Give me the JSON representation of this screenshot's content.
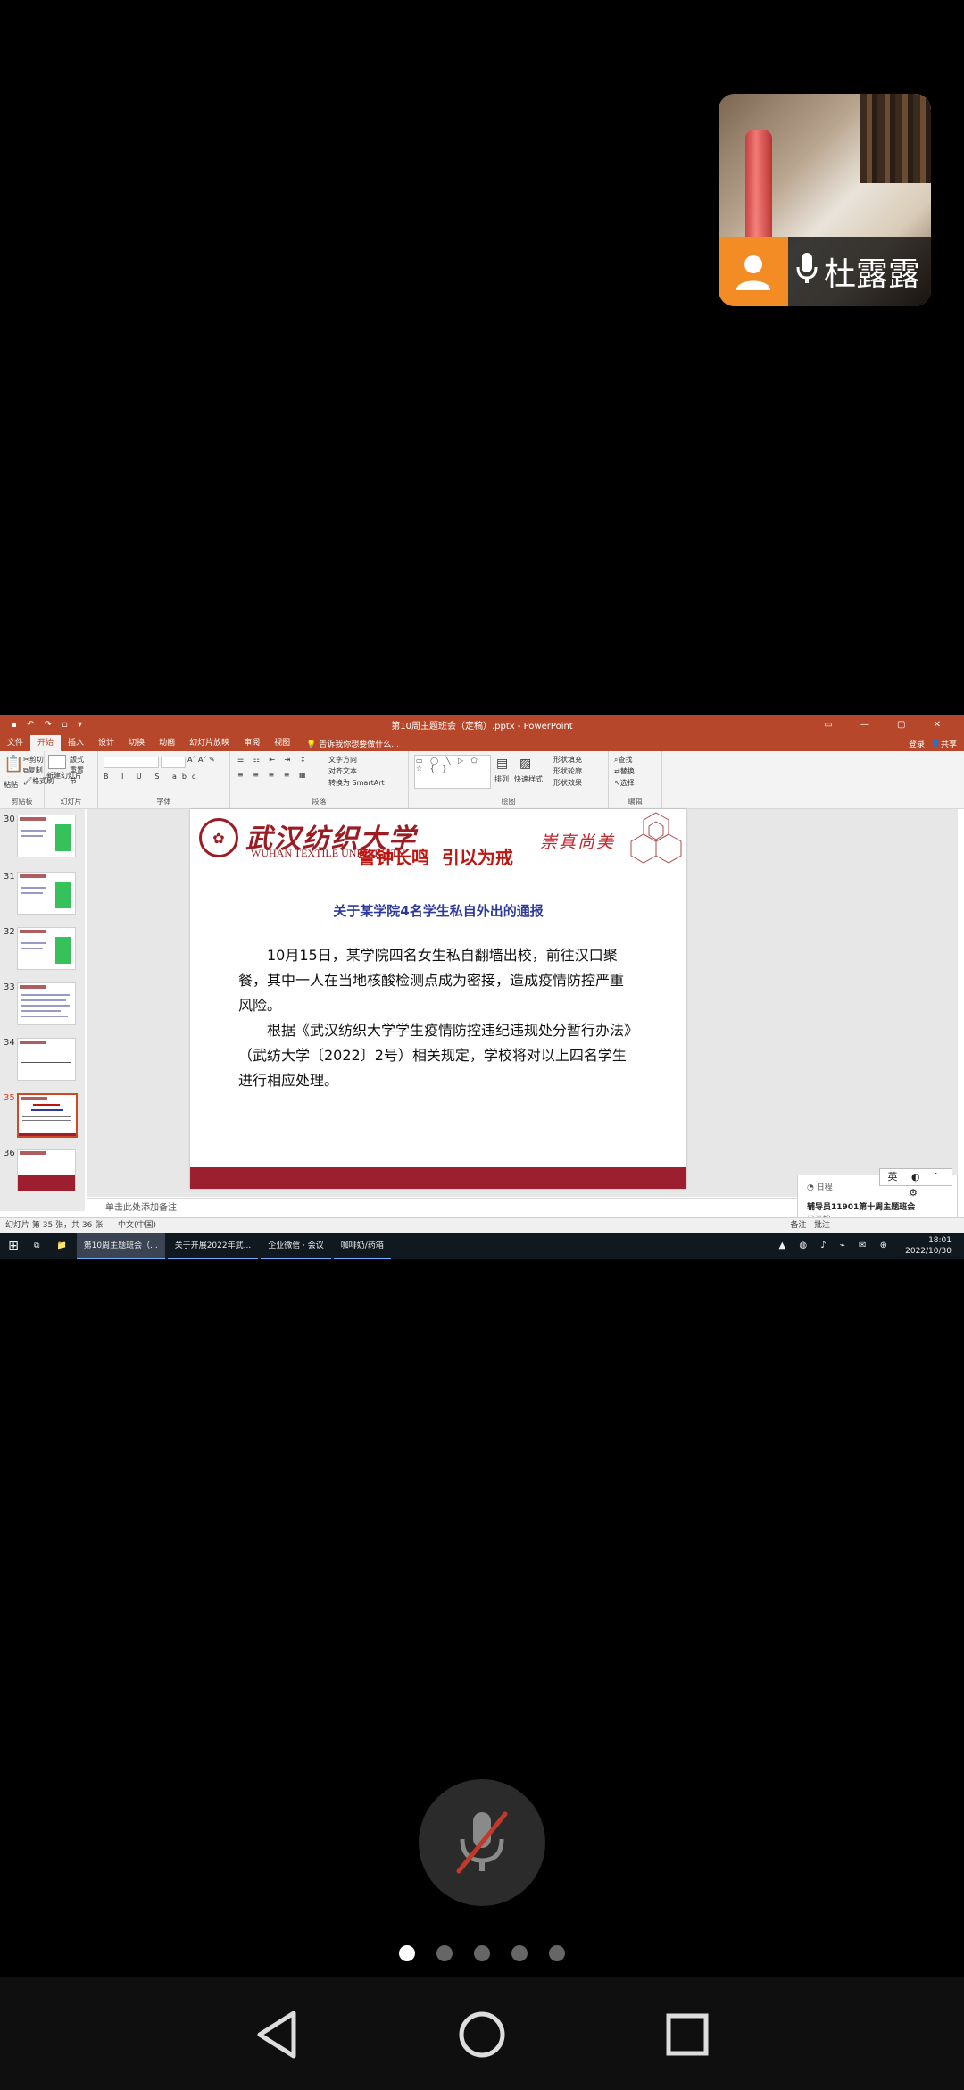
{
  "participant": {
    "name": "杜露露"
  },
  "screen": {
    "window_title": "第10周主题班会（定稿）.pptx - PowerPoint",
    "menu_tabs": [
      "文件",
      "开始",
      "插入",
      "设计",
      "切换",
      "动画",
      "幻灯片放映",
      "审阅",
      "视图"
    ],
    "active_tab": "开始",
    "tell_me": "告诉我你想要做什么...",
    "login": "登录",
    "share": "共享",
    "ribbon": {
      "clipboard": {
        "paste": "粘贴",
        "cut": "剪切",
        "copy": "复制",
        "format_painter": "格式刷",
        "label": "剪贴板"
      },
      "slides": {
        "new_slide": "新建幻灯片",
        "layout": "版式",
        "reset": "重置",
        "section": "节",
        "label": "幻灯片"
      },
      "font": {
        "label": "字体"
      },
      "paragraph": {
        "text_direction": "文字方向",
        "align_text": "对齐文本",
        "smartart": "转换为 SmartArt",
        "label": "段落"
      },
      "drawing": {
        "arrange": "排列",
        "quick_styles": "快速样式",
        "fill": "形状填充",
        "outline": "形状轮廓",
        "effects": "形状效果",
        "label": "绘图"
      },
      "editing": {
        "find": "查找",
        "replace": "替换",
        "select": "选择",
        "label": "编辑"
      }
    },
    "thumbnails": [
      {
        "num": "30",
        "kind": "green"
      },
      {
        "num": "31",
        "kind": "green"
      },
      {
        "num": "32",
        "kind": "green"
      },
      {
        "num": "33",
        "kind": "lines"
      },
      {
        "num": "34",
        "kind": "blank"
      },
      {
        "num": "35",
        "kind": "text",
        "active": true
      },
      {
        "num": "36",
        "kind": "red"
      }
    ],
    "slide": {
      "university_cn": "武汉纺织大学",
      "university_en": "WUHAN TEXTILE UNIVERSITY",
      "motto": "崇真尚美",
      "headline": "警钟长鸣  引以为戒",
      "subtitle": "关于某学院4名学生私自外出的通报",
      "paragraphs": [
        "10月15日，某学院四名女生私自翻墙出校，前往汉口聚餐，其中一人在当地核酸检测点成为密接，造成疫情防控严重风险。",
        "根据《武汉纺织大学学生疫情防控违纪违规处分暂行办法》（武纺大学〔2022〕2号）相关规定，学校将对以上四名学生进行相应处理。"
      ]
    },
    "notes_placeholder": "单击此处添加备注",
    "status": {
      "slide_count": "幻灯片 第 35 张，共 36 张",
      "language": "中文(中国)",
      "notes": "备注",
      "comments": "批注"
    },
    "popup": {
      "title": "日程",
      "line1": "辅导员11901第十周主题班会",
      "line2": "已开始"
    },
    "ime": "英",
    "taskbar": {
      "items": [
        "第10周主题班会（...",
        "关于开展2022年武...",
        "企业微信 · 会议",
        "咖啡奶/药箱"
      ],
      "time": "18:01",
      "date": "2022/10/30"
    }
  },
  "pager": {
    "count": 5,
    "active": 0
  }
}
